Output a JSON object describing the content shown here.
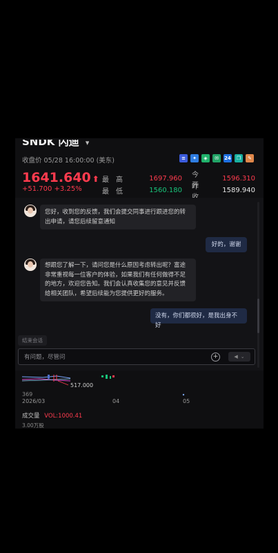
{
  "header": {
    "ticker": "SNDK",
    "ticker_suffix": "闪迪",
    "close_time": "收盘价 05/28 16:00:00 (美东)",
    "price": "1641.640",
    "change": "+51.700 +3.25%"
  },
  "icons": [
    {
      "name": "us-flag-icon",
      "color": "#3b5bdb",
      "glyph": "≡"
    },
    {
      "name": "tool-icon",
      "color": "#2f7de1",
      "glyph": "✦"
    },
    {
      "name": "shield-icon",
      "color": "#20b26b",
      "glyph": "◈"
    },
    {
      "name": "message-icon",
      "color": "#21a366",
      "glyph": "✉"
    },
    {
      "name": "24h-icon",
      "color": "#1e6fe0",
      "glyph": "24"
    },
    {
      "name": "copy-icon",
      "color": "#18b0a0",
      "glyph": "❐"
    },
    {
      "name": "edit-icon",
      "color": "#e0874a",
      "glyph": "✎"
    }
  ],
  "quote": {
    "high_label": "最高",
    "high": "1697.960",
    "open_label": "今开",
    "open": "1596.310",
    "low_label": "最低",
    "low": "1560.180",
    "prev_label": "昨收",
    "prev": "1589.940"
  },
  "chat": {
    "messages": [
      {
        "from": "agent",
        "text": "您好，收到您的反馈，我们会提交同事进行跟进您的转出申请，请您后续留意通知"
      },
      {
        "from": "user",
        "text": "好的，谢谢"
      },
      {
        "from": "agent",
        "text": "想跟您了解一下，请问您是什么原因考虑转出呢？富途非常重视每一位客户的体验，如果我们有任何做得不足的地方，欢迎您告知。我们会认真收集您的意见并反馈给相关团队，希望后续能为您提供更好的服务。"
      },
      {
        "from": "user",
        "text": "没有，你们都很好，是我出身不好"
      }
    ],
    "end_chip": "结束会话",
    "input_placeholder": "有问题，尽管问"
  },
  "chart_labels": {
    "y_label": "369",
    "annotation": "517.000",
    "x_ticks": [
      "2026/03",
      "04",
      "05"
    ]
  },
  "volume": {
    "label": "成交量",
    "value": "VOL:1000.41",
    "unit": "3.00万股"
  }
}
